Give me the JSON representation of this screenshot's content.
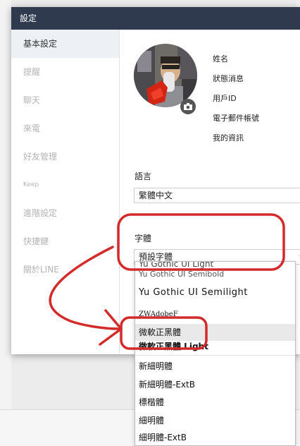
{
  "window": {
    "title": "設定"
  },
  "sidebar": {
    "items": [
      {
        "label": "基本設定"
      },
      {
        "label": "提醒"
      },
      {
        "label": "聊天"
      },
      {
        "label": "來電"
      },
      {
        "label": "好友管理"
      },
      {
        "label": "Keep"
      },
      {
        "label": "進階設定"
      },
      {
        "label": "快捷鍵"
      },
      {
        "label": "關於LINE"
      }
    ]
  },
  "profile": {
    "links": [
      "姓名",
      "狀態消息",
      "用戶ID",
      "電子郵件帳號",
      "我的資訊"
    ]
  },
  "language": {
    "label": "語言",
    "value": "繁體中文"
  },
  "font": {
    "label": "字體",
    "value": "預設字體",
    "options": [
      "Yu Gothic UI Light",
      "Yu Gothic UI Semibold",
      "Yu Gothic UI Semilight",
      "ZWAdobeF",
      "微軟正黑體",
      "微軟正黑體 Light",
      "新細明體",
      "新細明體-ExtB",
      "標楷體",
      "細明體",
      "細明體-ExtB"
    ]
  },
  "colors": {
    "titlebar": "#2f3a4f",
    "annotation": "#d42a2a",
    "selected_sidebar": "#edf0f5"
  },
  "icons": [
    "camera-icon",
    "chevron-down-icon"
  ]
}
